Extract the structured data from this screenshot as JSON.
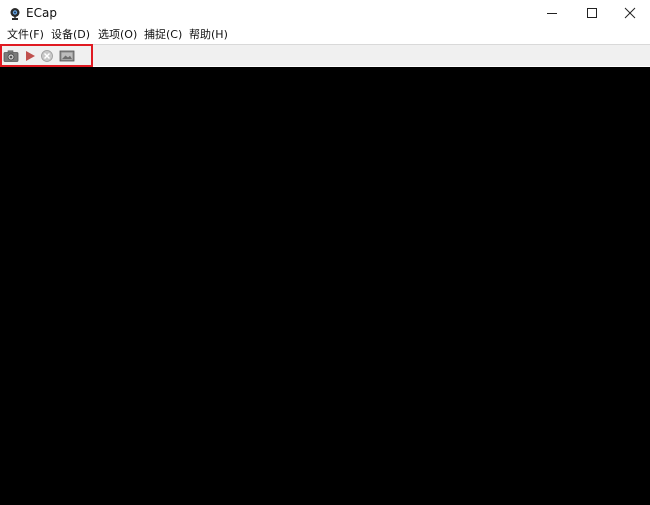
{
  "window": {
    "title": "ECap",
    "app_icon": "webcam-icon",
    "controls": [
      "minimize-icon",
      "maximize-icon",
      "close-icon"
    ]
  },
  "menu": {
    "items": [
      {
        "label": "文件(F)"
      },
      {
        "label": "设备(D)"
      },
      {
        "label": "选项(O)"
      },
      {
        "label": "捕捉(C)"
      },
      {
        "label": "帮助(H)"
      }
    ]
  },
  "toolbar": {
    "buttons": [
      {
        "icon": "camera-icon"
      },
      {
        "icon": "play-icon"
      },
      {
        "icon": "stop-icon"
      },
      {
        "icon": "image-icon"
      }
    ]
  },
  "colors": {
    "highlight": "#e01a22",
    "video_background": "#000000",
    "toolbar_background": "#f0f0f0"
  }
}
